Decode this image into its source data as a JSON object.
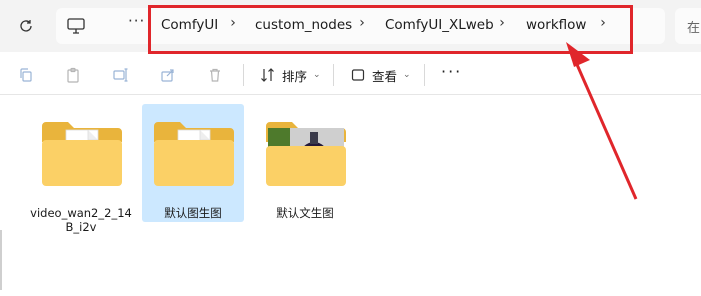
{
  "address_bar": {
    "refresh_icon": "refresh-icon",
    "pc_icon": "monitor-icon",
    "more_label": "···",
    "breadcrumbs": [
      "ComfyUI",
      "custom_nodes",
      "ComfyUI_XLweb",
      "workflow"
    ],
    "separator": "›",
    "search_partial": "在"
  },
  "toolbar": {
    "icons": [
      "copy-icon",
      "paste-icon",
      "rename-icon",
      "share-icon",
      "delete-icon"
    ],
    "sort_label": "排序",
    "view_label": "查看",
    "more_label": "···"
  },
  "items": [
    {
      "label": "video_wan2_2_14B_i2v",
      "type": "folder-with-document"
    },
    {
      "label": "默认图生图",
      "type": "folder-with-document",
      "selected": true
    },
    {
      "label": "默认文生图",
      "type": "folder-with-image"
    }
  ],
  "annotation": {
    "highlight_color": "#e0262b"
  }
}
